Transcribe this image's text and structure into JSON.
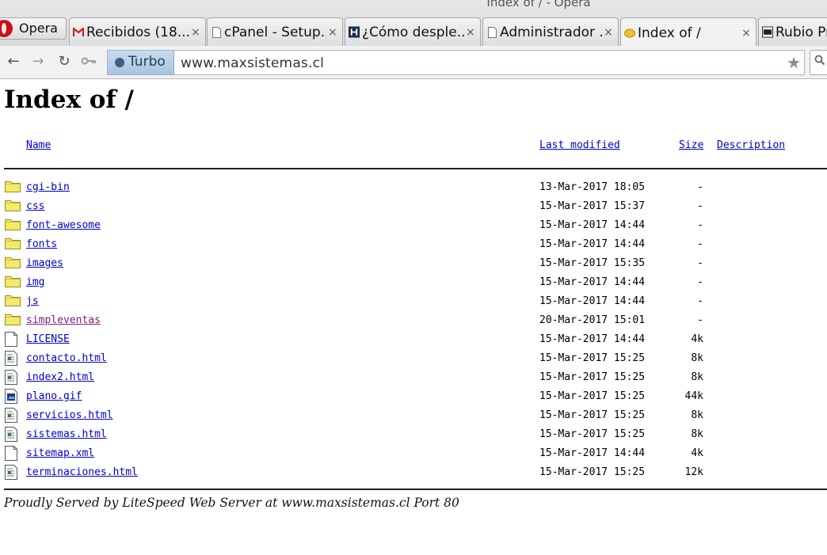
{
  "window": {
    "title": "Index of / - Opera"
  },
  "browser": {
    "menu_label": "Opera",
    "tabs": [
      {
        "label": "Recibidos (18...",
        "icon": "gmail-icon"
      },
      {
        "label": "cPanel - Setup...",
        "icon": "page-icon"
      },
      {
        "label": "¿Cómo desple...",
        "icon": "h-icon"
      },
      {
        "label": "Administrador ...",
        "icon": "page-icon"
      },
      {
        "label": "Index of /",
        "icon": "turbo-site-icon"
      },
      {
        "label": "Rubio Pr",
        "icon": "video-icon"
      }
    ],
    "turbo_label": "Turbo",
    "url": "www.maxsistemas.cl"
  },
  "page": {
    "title": "Index of /",
    "columns": {
      "name": "Name",
      "modified": "Last modified",
      "size": "Size",
      "description": "Description"
    },
    "files": [
      {
        "name": "cgi-bin",
        "modified": "13-Mar-2017 18:05",
        "size": "-",
        "type": "folder"
      },
      {
        "name": "css",
        "modified": "15-Mar-2017 15:37",
        "size": "-",
        "type": "folder"
      },
      {
        "name": "font-awesome",
        "modified": "15-Mar-2017 14:44",
        "size": "-",
        "type": "folder"
      },
      {
        "name": "fonts",
        "modified": "15-Mar-2017 14:44",
        "size": "-",
        "type": "folder"
      },
      {
        "name": "images",
        "modified": "15-Mar-2017 15:35",
        "size": "-",
        "type": "folder"
      },
      {
        "name": "img",
        "modified": "15-Mar-2017 14:44",
        "size": "-",
        "type": "folder"
      },
      {
        "name": "js",
        "modified": "15-Mar-2017 14:44",
        "size": "-",
        "type": "folder"
      },
      {
        "name": "simpleventas",
        "modified": "20-Mar-2017 15:01",
        "size": "-",
        "type": "folder",
        "visited": true
      },
      {
        "name": "LICENSE",
        "modified": "15-Mar-2017 14:44",
        "size": "4k",
        "type": "blank"
      },
      {
        "name": "contacto.html",
        "modified": "15-Mar-2017 15:25",
        "size": "8k",
        "type": "html"
      },
      {
        "name": "index2.html",
        "modified": "15-Mar-2017 15:25",
        "size": "8k",
        "type": "html"
      },
      {
        "name": "plano.gif",
        "modified": "15-Mar-2017 15:25",
        "size": "44k",
        "type": "image"
      },
      {
        "name": "servicios.html",
        "modified": "15-Mar-2017 15:25",
        "size": "8k",
        "type": "html"
      },
      {
        "name": "sistemas.html",
        "modified": "15-Mar-2017 15:25",
        "size": "8k",
        "type": "html"
      },
      {
        "name": "sitemap.xml",
        "modified": "15-Mar-2017 14:44",
        "size": "4k",
        "type": "blank"
      },
      {
        "name": "terminaciones.html",
        "modified": "15-Mar-2017 15:25",
        "size": "12k",
        "type": "html"
      }
    ],
    "footer": "Proudly Served by LiteSpeed Web Server at www.maxsistemas.cl Port 80"
  },
  "colors": {
    "link": "#0000cc",
    "visited": "#80207f",
    "folder": "#f2ea6a"
  }
}
